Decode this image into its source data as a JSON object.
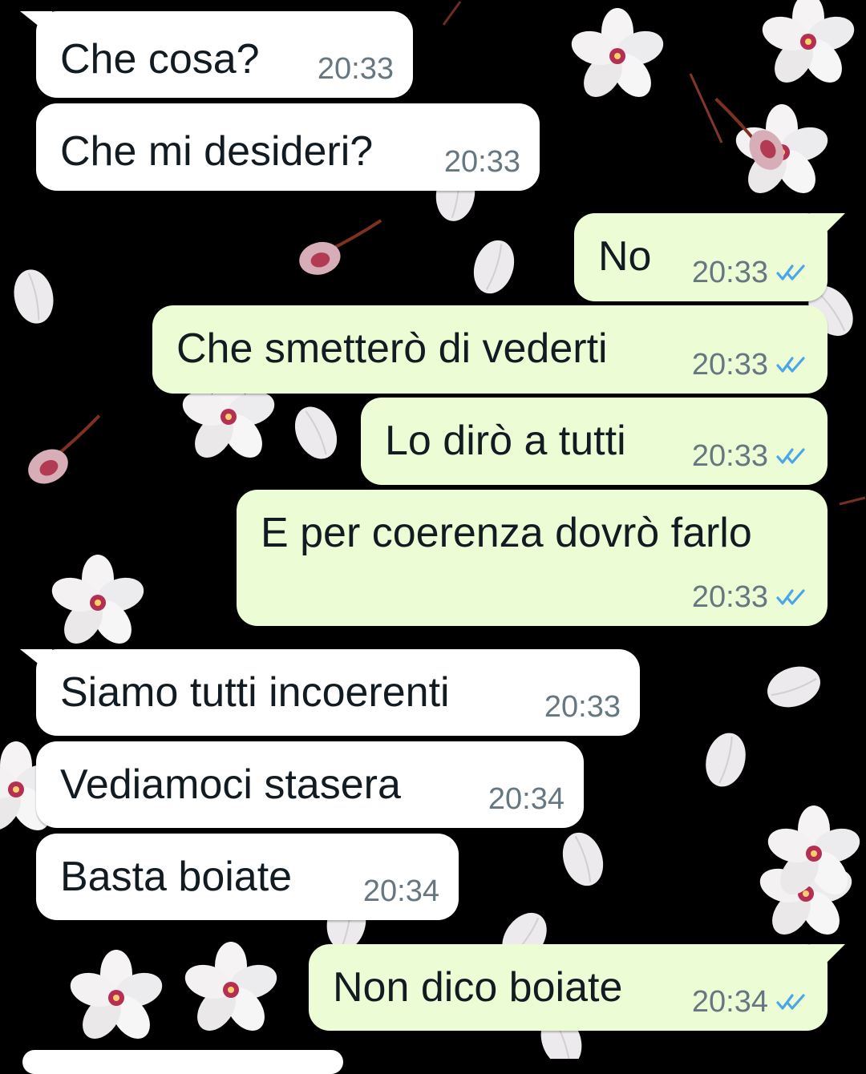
{
  "colors": {
    "incoming_bubble": "#ffffff",
    "outgoing_bubble": "#ecfdd6",
    "timestamp": "#667781",
    "read_ticks": "#4aa6e8",
    "wallpaper_background": "#000000"
  },
  "wallpaper": {
    "description_icon": "cherry-blossom-petals-pattern"
  },
  "messages": [
    {
      "direction": "incoming",
      "text": "Che cosa?",
      "time": "20:33"
    },
    {
      "direction": "incoming",
      "text": "Che mi desideri?",
      "time": "20:33"
    },
    {
      "direction": "outgoing",
      "text": "No",
      "time": "20:33",
      "status_icon": "double-check-read-icon"
    },
    {
      "direction": "outgoing",
      "text": "Che smetterò di vederti",
      "time": "20:33",
      "status_icon": "double-check-read-icon"
    },
    {
      "direction": "outgoing",
      "text": "Lo dirò a tutti",
      "time": "20:33",
      "status_icon": "double-check-read-icon"
    },
    {
      "direction": "outgoing",
      "text": "E per coerenza dovrò farlo",
      "time": "20:33",
      "status_icon": "double-check-read-icon"
    },
    {
      "direction": "incoming",
      "text": "Siamo tutti incoerenti",
      "time": "20:33"
    },
    {
      "direction": "incoming",
      "text": "Vediamoci stasera",
      "time": "20:34"
    },
    {
      "direction": "incoming",
      "text": "Basta boiate",
      "time": "20:34"
    },
    {
      "direction": "outgoing",
      "text": "Non dico boiate",
      "time": "20:34",
      "status_icon": "double-check-read-icon"
    }
  ]
}
